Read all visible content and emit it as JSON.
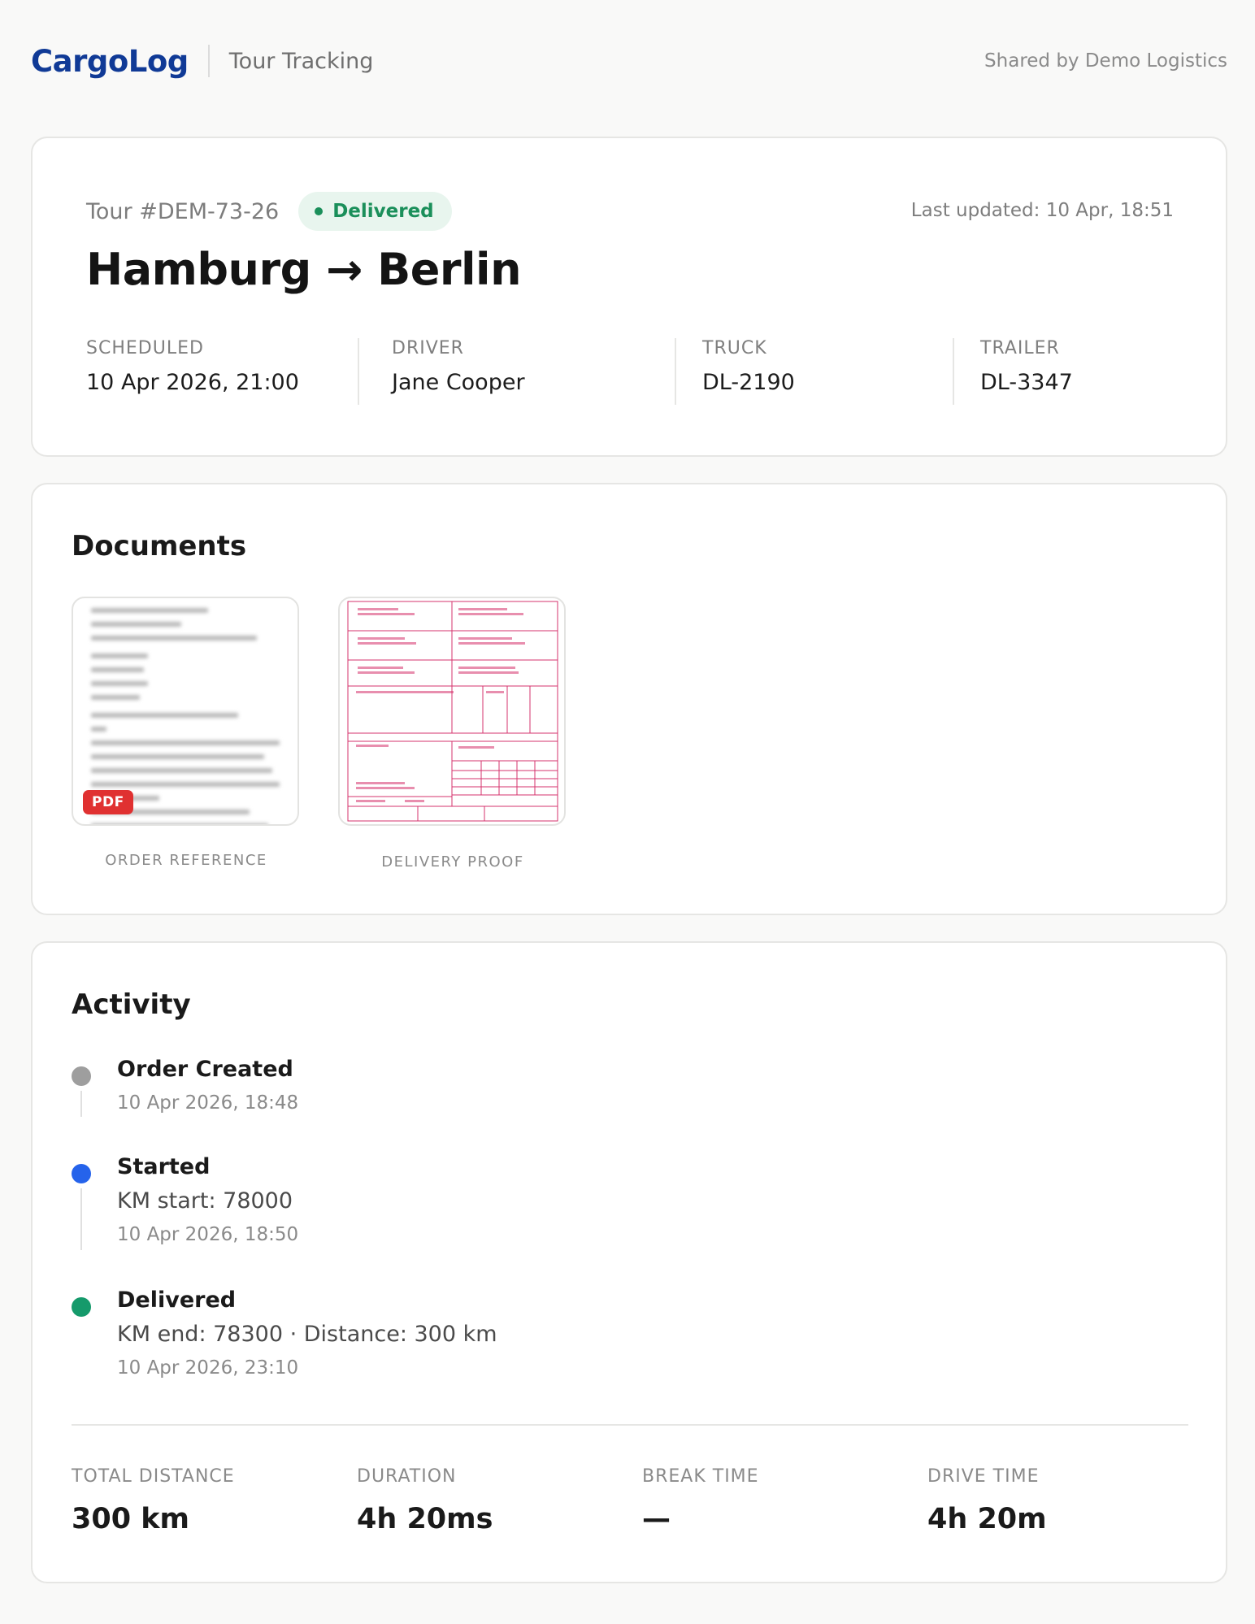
{
  "header": {
    "brand": "CargoLog",
    "subtitle": "Tour Tracking",
    "shared_by": "Shared by Demo Logistics"
  },
  "tour": {
    "id": "Tour #DEM-73-26",
    "status": "Delivered",
    "status_color": "#1a8f5a",
    "last_updated": "Last updated: 10 Apr, 18:51",
    "route": "Hamburg → Berlin",
    "meta": [
      {
        "label": "SCHEDULED",
        "value": "10 Apr 2026, 21:00"
      },
      {
        "label": "DRIVER",
        "value": "Jane Cooper"
      },
      {
        "label": "TRUCK",
        "value": "DL-2190"
      },
      {
        "label": "TRAILER",
        "value": "DL-3347"
      }
    ]
  },
  "documents": {
    "title": "Documents",
    "items": [
      {
        "label": "ORDER REFERENCE",
        "badge": "PDF",
        "icon": "pdf-thumbnail"
      },
      {
        "label": "DELIVERY PROOF",
        "icon": "form-thumbnail"
      }
    ]
  },
  "activity": {
    "title": "Activity",
    "events": [
      {
        "title": "Order Created",
        "detail": "",
        "time": "10 Apr 2026, 18:48",
        "color": "#9e9e9e"
      },
      {
        "title": "Started",
        "detail": "KM start: 78000",
        "time": "10 Apr 2026, 18:50",
        "color": "#2563eb"
      },
      {
        "title": "Delivered",
        "detail": "KM end: 78300 · Distance: 300 km",
        "time": "10 Apr 2026, 23:10",
        "color": "#159a6b"
      }
    ],
    "stats": [
      {
        "label": "TOTAL DISTANCE",
        "value": "300 km"
      },
      {
        "label": "DURATION",
        "value": "4h 20ms"
      },
      {
        "label": "BREAK TIME",
        "value": "—"
      },
      {
        "label": "DRIVE TIME",
        "value": "4h 20m"
      }
    ]
  }
}
